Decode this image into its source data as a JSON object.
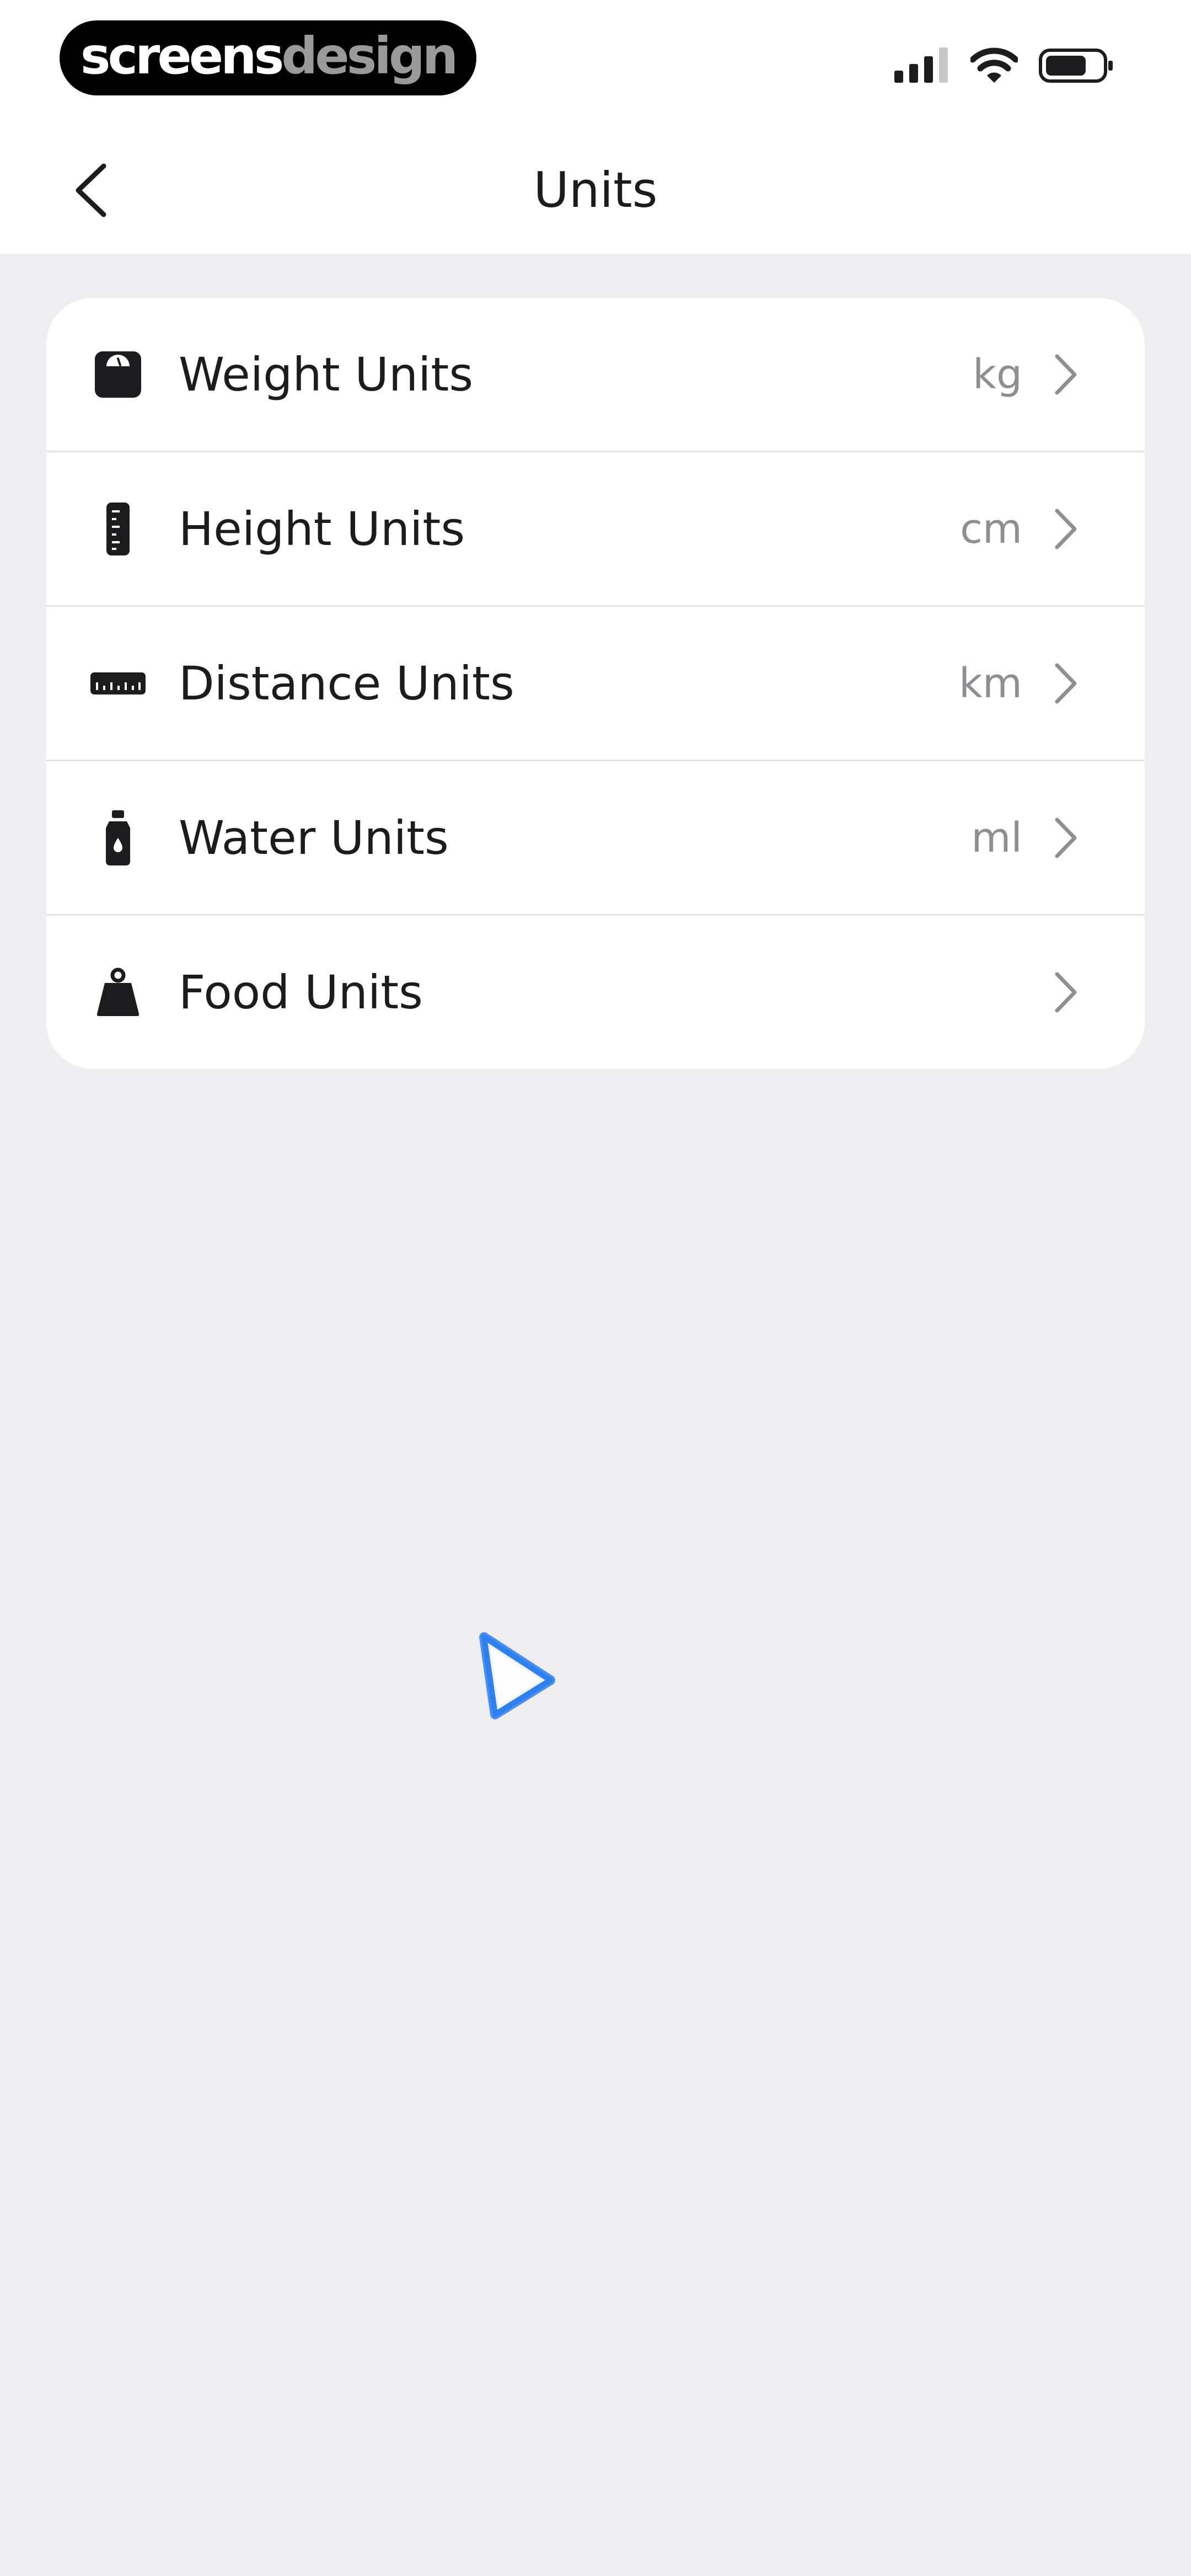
{
  "status_bar": {
    "brand_primary": "screens",
    "brand_secondary": "design",
    "icons": [
      "signal-icon",
      "wifi-icon",
      "battery-icon"
    ]
  },
  "nav": {
    "title": "Units",
    "back_icon": "chevron-left-icon"
  },
  "units": [
    {
      "label": "Weight Units",
      "value": "kg",
      "icon": "scale-icon"
    },
    {
      "label": "Height Units",
      "value": "cm",
      "icon": "ruler-vertical-icon"
    },
    {
      "label": "Distance Units",
      "value": "km",
      "icon": "ruler-horizontal-icon"
    },
    {
      "label": "Water Units",
      "value": "ml",
      "icon": "water-bottle-icon"
    },
    {
      "label": "Food Units",
      "value": "",
      "icon": "weight-bag-icon"
    }
  ],
  "colors": {
    "background": "#eeeef0",
    "surface": "#ffffff",
    "text_primary": "#1c1c1e",
    "text_secondary": "#8e8e93",
    "divider": "#e5e5e7",
    "cursor_blue": "#2f80ed"
  }
}
